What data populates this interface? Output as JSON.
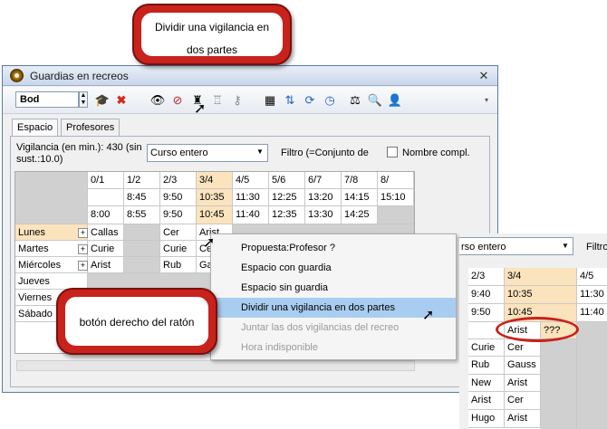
{
  "window": {
    "title": "Guardias en recreos"
  },
  "toolbar": {
    "combo_value": "Bod",
    "icons": [
      "graduation-cap-icon",
      "delete-x-icon",
      "eye-icon",
      "eye-crossed-icon",
      "teacher-icon",
      "teacher-split-icon",
      "key-icon",
      "calculator-icon",
      "import-icon",
      "refresh-icon",
      "clock-icon",
      "scale-icon",
      "search-icon",
      "user-icon"
    ]
  },
  "tabs": [
    {
      "label": "Espacio"
    },
    {
      "label": "Profesores"
    }
  ],
  "filters": {
    "vigilancia": "Vigilancia (en min.): 430 (sin sust.:10.0)",
    "curso": "Curso entero",
    "filtro": "Filtro (=Conjunto de",
    "nombre_compl": "Nombre compl."
  },
  "grid": {
    "periods": [
      "0/1",
      "1/2",
      "2/3",
      "3/4",
      "4/5",
      "5/6",
      "6/7",
      "7/8",
      "8/"
    ],
    "start_times": [
      "",
      "8:45",
      "9:50",
      "10:35",
      "11:30",
      "12:25",
      "13:20",
      "14:15",
      "15:10"
    ],
    "end_times": [
      "8:00",
      "8:55",
      "9:50",
      "10:45",
      "11:40",
      "12:35",
      "13:30",
      "14:25",
      ""
    ],
    "rows": [
      {
        "day": "Lunes",
        "c0": "Callas",
        "c2": "Cer",
        "c3": "Arist"
      },
      {
        "day": "Martes",
        "c0": "Curie",
        "c2": "Curie",
        "c3": "Cer"
      },
      {
        "day": "Miércoles",
        "c0": "Arist",
        "c2": "Rub",
        "c3": "Gaus"
      },
      {
        "day": "Jueves"
      },
      {
        "day": "Viernes"
      },
      {
        "day": "Sábado"
      }
    ]
  },
  "context_menu": {
    "items": [
      {
        "label": "Propuesta:Profesor ?"
      },
      {
        "label": "Espacio con guardia"
      },
      {
        "label": "Espacio sin guardia"
      },
      {
        "label": "Dividir una vigilancia en dos partes"
      },
      {
        "label": "Juntar las dos vigilancias del recreo"
      },
      {
        "label": "Hora indisponible"
      }
    ]
  },
  "inset": {
    "combo": "rso entero",
    "filtro": "Filtro",
    "headers": [
      "2/3",
      "3/4",
      "4/5"
    ],
    "times_start": [
      "9:40",
      "10:35",
      "11:30"
    ],
    "times_end": [
      "9:50",
      "10:45",
      "11:40"
    ],
    "split": [
      "Arist",
      "???"
    ],
    "rows": [
      {
        "a": "Curie",
        "b": "Cer"
      },
      {
        "a": "Rub",
        "b": "Gauss"
      },
      {
        "a": "New",
        "b": "Arist"
      },
      {
        "a": "Arist",
        "b": "Cer"
      },
      {
        "a": "Hugo",
        "b": "Arist"
      }
    ]
  },
  "callouts": {
    "split_line1": "Dividir una vigilancia en",
    "split_line2": "dos partes",
    "right_click": "botón derecho del ratón"
  },
  "colors": {
    "callout": "#c8221c",
    "highlight": "#fbe3bd",
    "menu_selection": "#a9cdf0"
  }
}
